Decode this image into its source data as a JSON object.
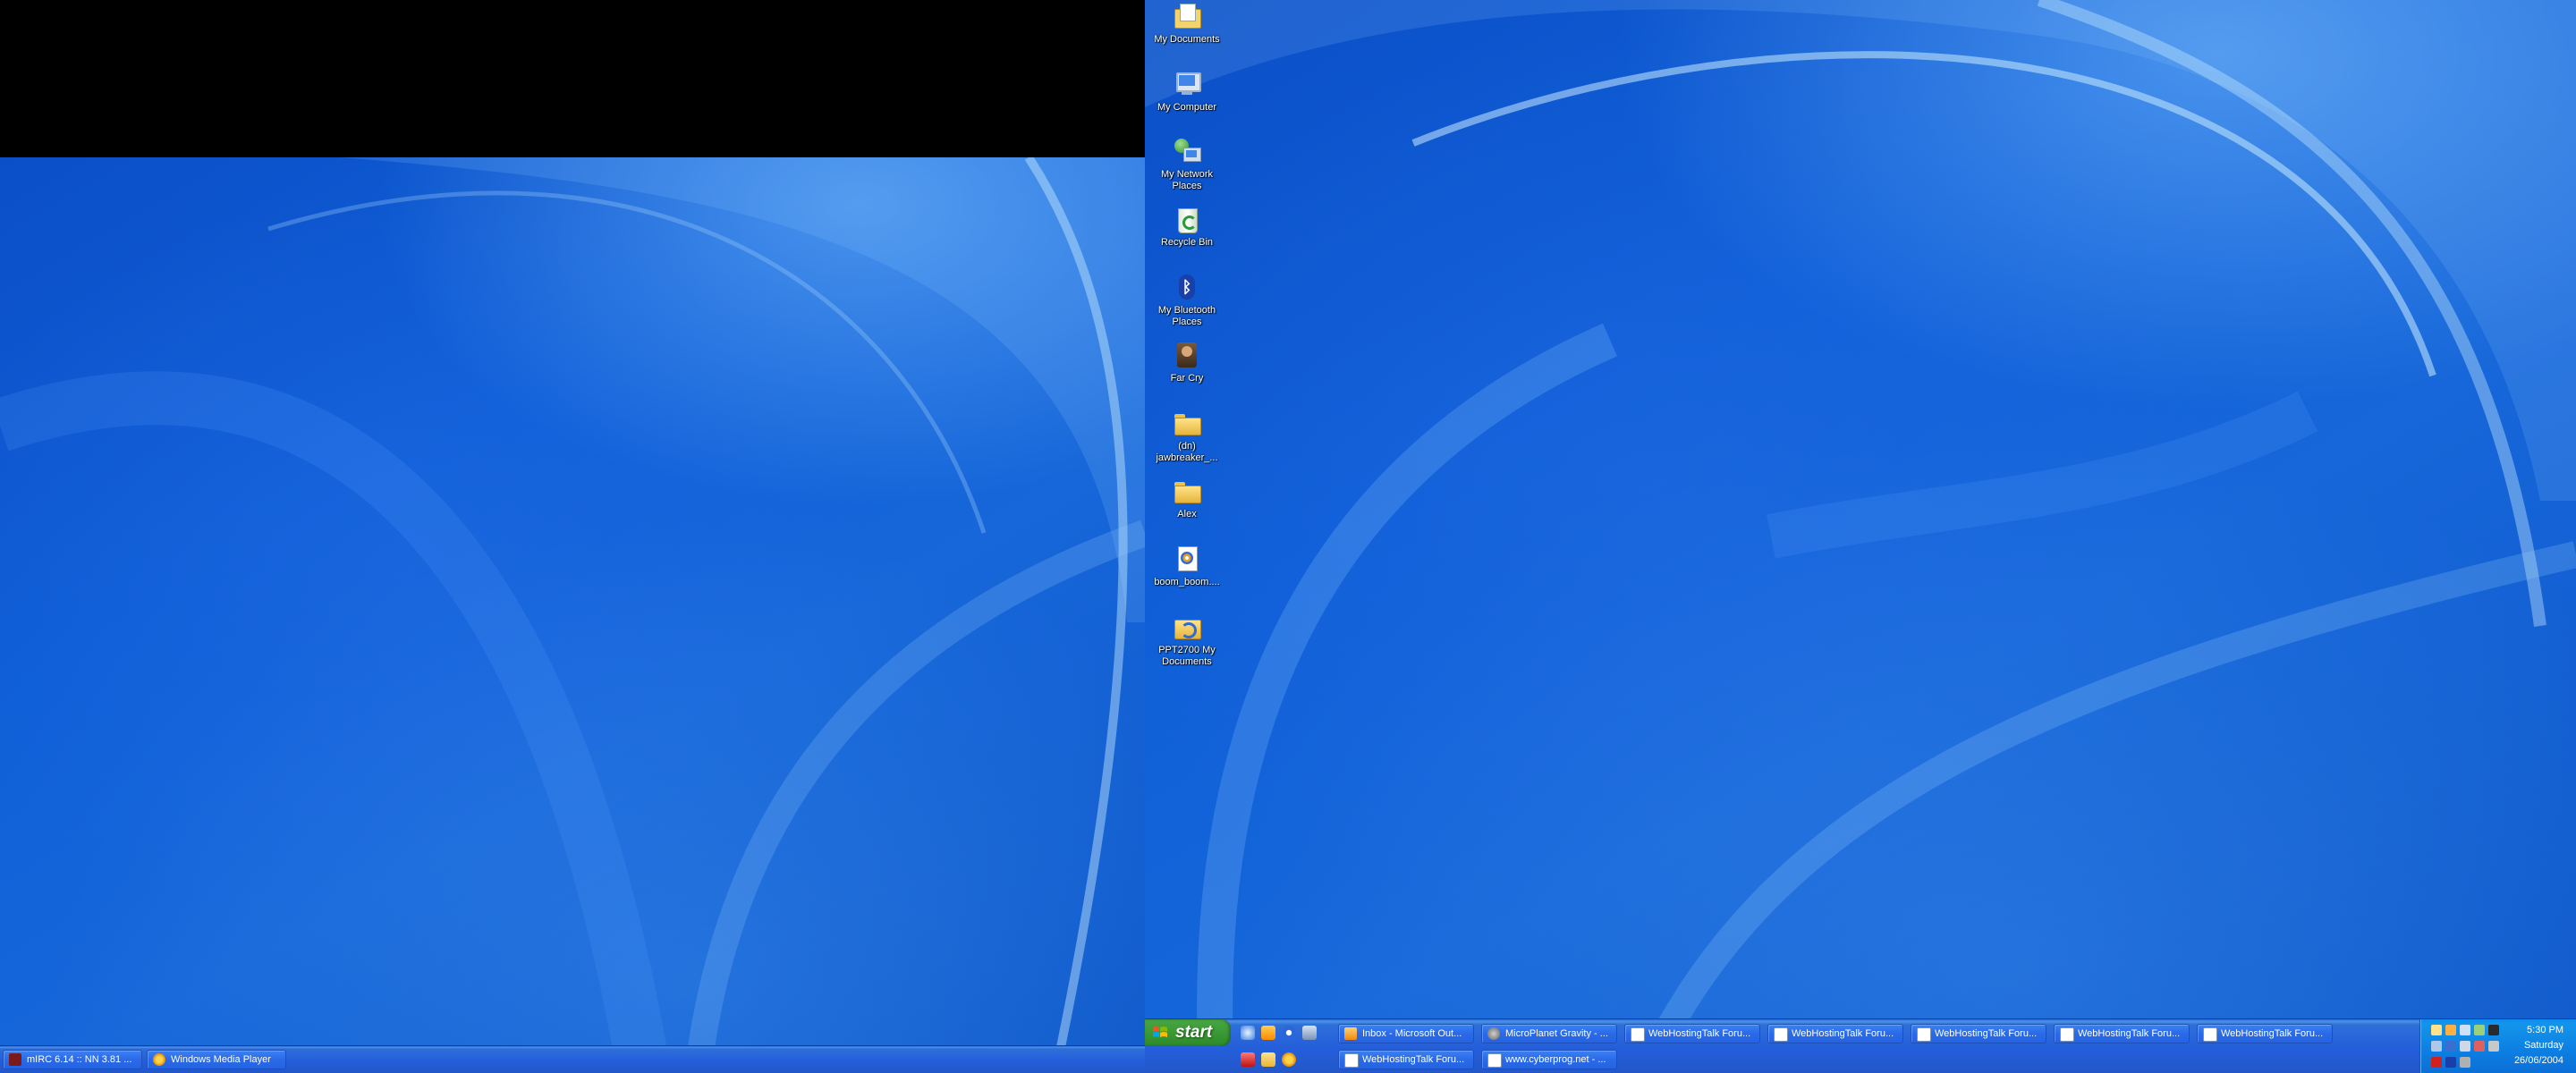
{
  "desktop": {
    "icons": [
      {
        "label": "My Documents",
        "icon": "my-documents-icon"
      },
      {
        "label": "My Computer",
        "icon": "my-computer-icon"
      },
      {
        "label": "My Network Places",
        "icon": "network-places-icon"
      },
      {
        "label": "Recycle Bin",
        "icon": "recycle-bin-icon"
      },
      {
        "label": "My Bluetooth Places",
        "icon": "bluetooth-icon"
      },
      {
        "label": "Far Cry",
        "icon": "far-cry-icon"
      },
      {
        "label": "(dn) jawbreaker_...",
        "icon": "folder-icon"
      },
      {
        "label": "Alex",
        "icon": "folder-icon"
      },
      {
        "label": "boom_boom....",
        "icon": "media-file-icon"
      },
      {
        "label": "PPT2700 My Documents",
        "icon": "sync-folder-icon"
      }
    ]
  },
  "left_taskbar": {
    "buttons": [
      {
        "label": "mIRC 6.14 :: NN 3.81 ...",
        "icon": "mirc-icon"
      },
      {
        "label": "Windows Media Player",
        "icon": "media-player-icon"
      }
    ]
  },
  "right_taskbar": {
    "start_label": "start",
    "row1": [
      {
        "label": "Inbox - Microsoft Out...",
        "icon": "outlook-icon"
      },
      {
        "label": "MicroPlanet Gravity - ...",
        "icon": "gravity-icon"
      },
      {
        "label": "WebHostingTalk Foru...",
        "icon": "browser-page-icon"
      },
      {
        "label": "WebHostingTalk Foru...",
        "icon": "browser-page-icon"
      },
      {
        "label": "WebHostingTalk Foru...",
        "icon": "browser-page-icon"
      },
      {
        "label": "WebHostingTalk Foru...",
        "icon": "browser-page-icon"
      },
      {
        "label": "WebHostingTalk Foru...",
        "icon": "browser-page-icon"
      }
    ],
    "row2": [
      {
        "label": "WebHostingTalk Foru...",
        "icon": "browser-page-icon"
      },
      {
        "label": "www.cyberprog.net - ...",
        "icon": "browser-page-icon"
      }
    ],
    "clock": {
      "time": "5:30 PM",
      "day": "Saturday",
      "date": "26/06/2004"
    }
  },
  "colors": {
    "taskbar": "#245edb",
    "start": "#3c9a37",
    "tray": "#0f8cf0",
    "wallpaper": "#0f5fd8"
  }
}
